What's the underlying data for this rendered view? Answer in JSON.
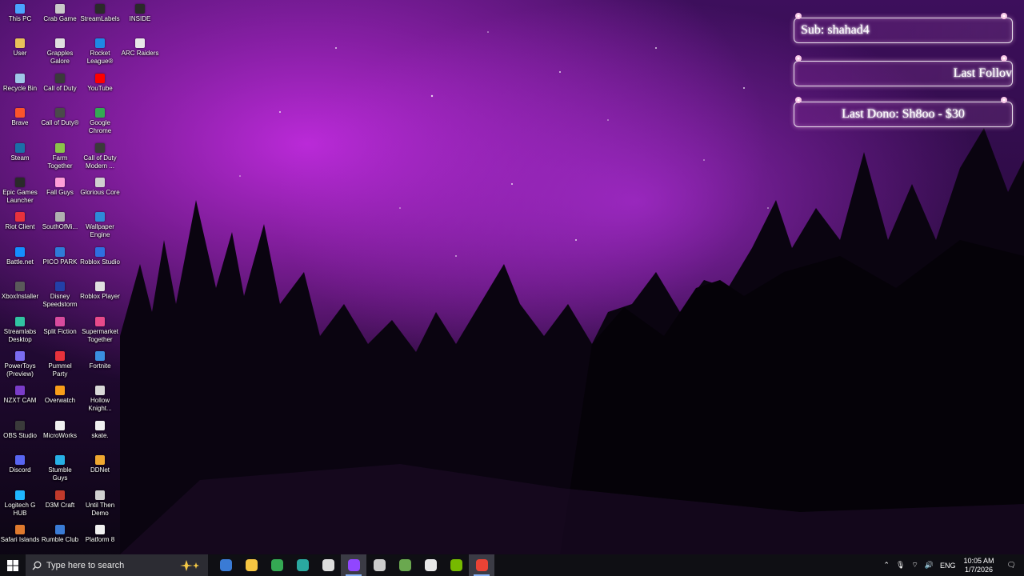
{
  "desktop": {
    "icons": [
      {
        "label": "This PC",
        "color": "#4aa3ff"
      },
      {
        "label": "User",
        "color": "#e8c15a"
      },
      {
        "label": "Recycle Bin",
        "color": "#9fc6e8"
      },
      {
        "label": "Brave",
        "color": "#fb542b"
      },
      {
        "label": "Steam",
        "color": "#1b6fa8"
      },
      {
        "label": "Epic Games Launcher",
        "color": "#2a2a2a"
      },
      {
        "label": "Riot Client",
        "color": "#e8323c"
      },
      {
        "label": "Battle.net",
        "color": "#148eff"
      },
      {
        "label": "XboxInstaller",
        "color": "#5a5a5a"
      },
      {
        "label": "Streamlabs Desktop",
        "color": "#31c3a2"
      },
      {
        "label": "PowerToys (Preview)",
        "color": "#7b6cf0"
      },
      {
        "label": "NZXT CAM",
        "color": "#7a3cc9"
      },
      {
        "label": "OBS Studio",
        "color": "#3a3a3a"
      },
      {
        "label": "Discord",
        "color": "#5865f2"
      },
      {
        "label": "Logitech G HUB",
        "color": "#1fb6ff"
      },
      {
        "label": "Safari Islands",
        "color": "#e07a2e"
      },
      {
        "label": "Crab Game",
        "color": "#c9c9c9"
      },
      {
        "label": "Grapples Galore",
        "color": "#e0e0e0"
      },
      {
        "label": "Call of Duty",
        "color": "#3a3a3a"
      },
      {
        "label": "Call of Duty®",
        "color": "#4a4a4a"
      },
      {
        "label": "Farm Together",
        "color": "#8bc34a"
      },
      {
        "label": "Fall Guys",
        "color": "#ff9ed8"
      },
      {
        "label": "SouthOfMi...",
        "color": "#b0b0b0"
      },
      {
        "label": "PICO PARK",
        "color": "#2f7bd8"
      },
      {
        "label": "Disney Speedstorm",
        "color": "#2340a8"
      },
      {
        "label": "Split Fiction",
        "color": "#d84b9e"
      },
      {
        "label": "Pummel Party",
        "color": "#e8323c"
      },
      {
        "label": "Overwatch",
        "color": "#f99e1a"
      },
      {
        "label": "MicroWorks",
        "color": "#f0f0f0"
      },
      {
        "label": "Stumble Guys",
        "color": "#27b0e6"
      },
      {
        "label": "D3M Craft",
        "color": "#c0392b"
      },
      {
        "label": "Rumble Club",
        "color": "#3a7bd5"
      },
      {
        "label": "StreamLabels",
        "color": "#2a2a2a"
      },
      {
        "label": "Rocket League®",
        "color": "#1e88e5"
      },
      {
        "label": "YouTube",
        "color": "#ff0000"
      },
      {
        "label": "Google Chrome",
        "color": "#34a853"
      },
      {
        "label": "Call of Duty Modern ...",
        "color": "#3a3a3a"
      },
      {
        "label": "Glorious Core",
        "color": "#d0d0d0"
      },
      {
        "label": "Wallpaper Engine",
        "color": "#2e8bd8"
      },
      {
        "label": "Roblox Studio",
        "color": "#2f6fe0"
      },
      {
        "label": "Roblox Player",
        "color": "#e0e0e0"
      },
      {
        "label": "Supermarket Together",
        "color": "#e84a8a"
      },
      {
        "label": "Fortnite",
        "color": "#3a8fe0"
      },
      {
        "label": "Hollow Knight...",
        "color": "#d8d8d8"
      },
      {
        "label": "skate.",
        "color": "#f0f0f0"
      },
      {
        "label": "DDNet",
        "color": "#f0a830"
      },
      {
        "label": "Until Then Demo",
        "color": "#d0d0d0"
      },
      {
        "label": "Platform 8",
        "color": "#f0f0f0"
      },
      {
        "label": "INSIDE",
        "color": "#2a2a2a"
      },
      {
        "label": "ARC Raiders",
        "color": "#e8e8e8"
      }
    ]
  },
  "widgets": {
    "sub": "Sub: shahad4",
    "follow": "Last Follov",
    "dono": "Last Dono: Sh8oo - $30"
  },
  "taskbar": {
    "search_placeholder": "Type here to search",
    "apps": [
      {
        "name": "store",
        "color": "#3a7bd5"
      },
      {
        "name": "file-explorer",
        "color": "#f5c542"
      },
      {
        "name": "chrome",
        "color": "#34a853"
      },
      {
        "name": "edge",
        "color": "#2aa8a0"
      },
      {
        "name": "steam",
        "color": "#dddddd"
      },
      {
        "name": "twitch-studio",
        "color": "#9146ff"
      },
      {
        "name": "obs",
        "color": "#cccccc"
      },
      {
        "name": "minecraft",
        "color": "#6aa84f"
      },
      {
        "name": "package",
        "color": "#e8e8e8"
      },
      {
        "name": "nvidia",
        "color": "#76b900"
      },
      {
        "name": "chrome-profile",
        "color": "#ea4335"
      }
    ],
    "tray": {
      "language": "ENG",
      "time": "10:05 AM",
      "date": "1/7/2026"
    }
  }
}
